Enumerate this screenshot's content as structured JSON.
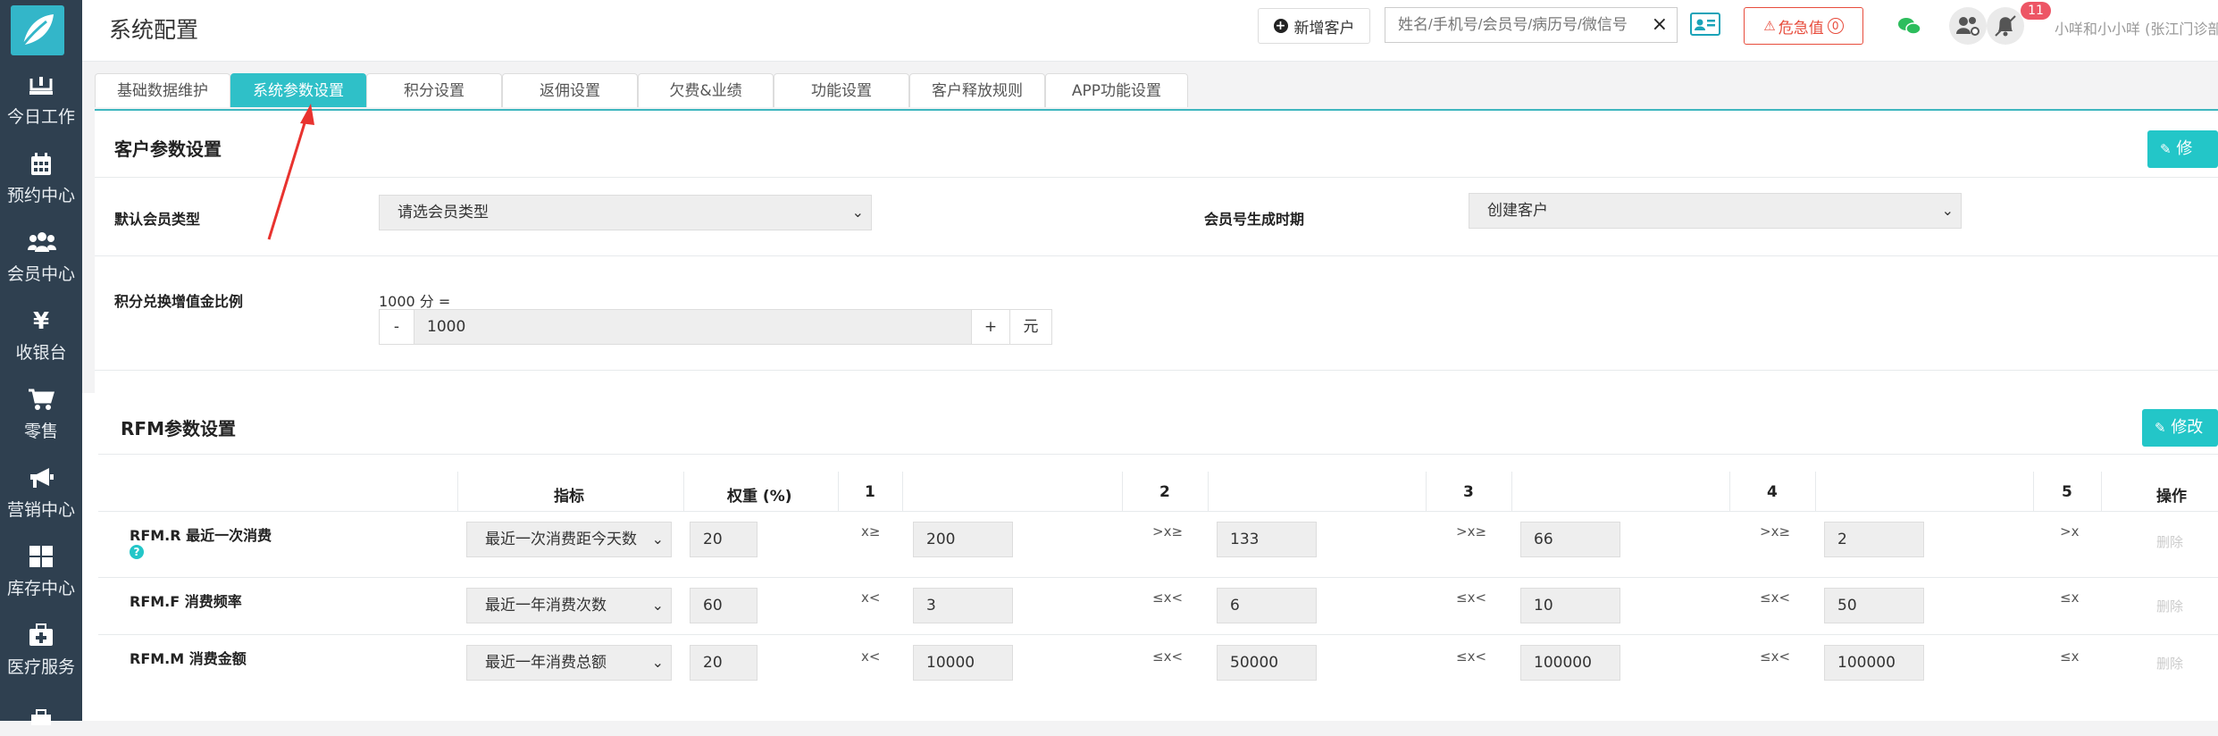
{
  "header": {
    "title": "系统配置",
    "new_customer": "新增客户",
    "search_placeholder": "姓名/手机号/会员号/病历号/微信号",
    "clear": "×",
    "danger_label": "危急值",
    "danger_count": "0",
    "notification_count": "11",
    "user": "小咩和小小咩 (张江门诊部)"
  },
  "sidebar": {
    "items": [
      {
        "label": "今日工作",
        "icon": "inbox-icon"
      },
      {
        "label": "预约中心",
        "icon": "calendar-icon"
      },
      {
        "label": "会员中心",
        "icon": "users-icon"
      },
      {
        "label": "收银台",
        "icon": "yen-icon"
      },
      {
        "label": "零售",
        "icon": "cart-icon"
      },
      {
        "label": "营销中心",
        "icon": "megaphone-icon"
      },
      {
        "label": "库存中心",
        "icon": "grid-icon"
      },
      {
        "label": "医疗服务",
        "icon": "medkit-icon"
      }
    ]
  },
  "tabs": [
    {
      "label": "基础数据维护"
    },
    {
      "label": "系统参数设置"
    },
    {
      "label": "积分设置"
    },
    {
      "label": "返佣设置"
    },
    {
      "label": "欠费&业绩"
    },
    {
      "label": "功能设置"
    },
    {
      "label": "客户释放规则"
    },
    {
      "label": "APP功能设置"
    }
  ],
  "customer_section": {
    "title": "客户参数设置",
    "edit": "修改",
    "default_member_type_label": "默认会员类型",
    "default_member_type_value": "请选会员类型",
    "member_no_label": "会员号生成时期",
    "member_no_value": "创建客户",
    "points_label": "积分兑换增值金比例",
    "points_hint": "1000 分 =",
    "minus": "-",
    "points_value": "1000",
    "plus": "+",
    "unit": "元"
  },
  "rfm_section": {
    "title": "RFM参数设置",
    "edit": "修改",
    "headers": {
      "indicator": "指标",
      "weight": "权重 (%)",
      "c1": "1",
      "c2": "2",
      "c3": "3",
      "c4": "4",
      "c5": "5",
      "action": "操作"
    },
    "rows": [
      {
        "name": "RFM.R 最近一次消费",
        "indicator": "最近一次消费距今天数",
        "weight": "20",
        "ops": [
          "x≥",
          ">x≥",
          ">x≥",
          ">x≥",
          ">x"
        ],
        "values": [
          "200",
          "133",
          "66",
          "2"
        ],
        "action": "删除"
      },
      {
        "name": "RFM.F 消费频率",
        "indicator": "最近一年消费次数",
        "weight": "60",
        "ops": [
          "x<",
          "≤x<",
          "≤x<",
          "≤x<",
          "≤x"
        ],
        "values": [
          "3",
          "6",
          "10",
          "50"
        ],
        "action": "删除"
      },
      {
        "name": "RFM.M 消费金额",
        "indicator": "最近一年消费总额",
        "weight": "20",
        "ops": [
          "x<",
          "≤x<",
          "≤x<",
          "≤x<",
          "≤x"
        ],
        "values": [
          "10000",
          "50000",
          "100000",
          "100000"
        ],
        "action": "删除"
      }
    ]
  },
  "colors": {
    "accent": "#23c6c8",
    "sidebar": "#2f4050",
    "danger": "#e74c3c",
    "annotation": "#e8332f"
  }
}
